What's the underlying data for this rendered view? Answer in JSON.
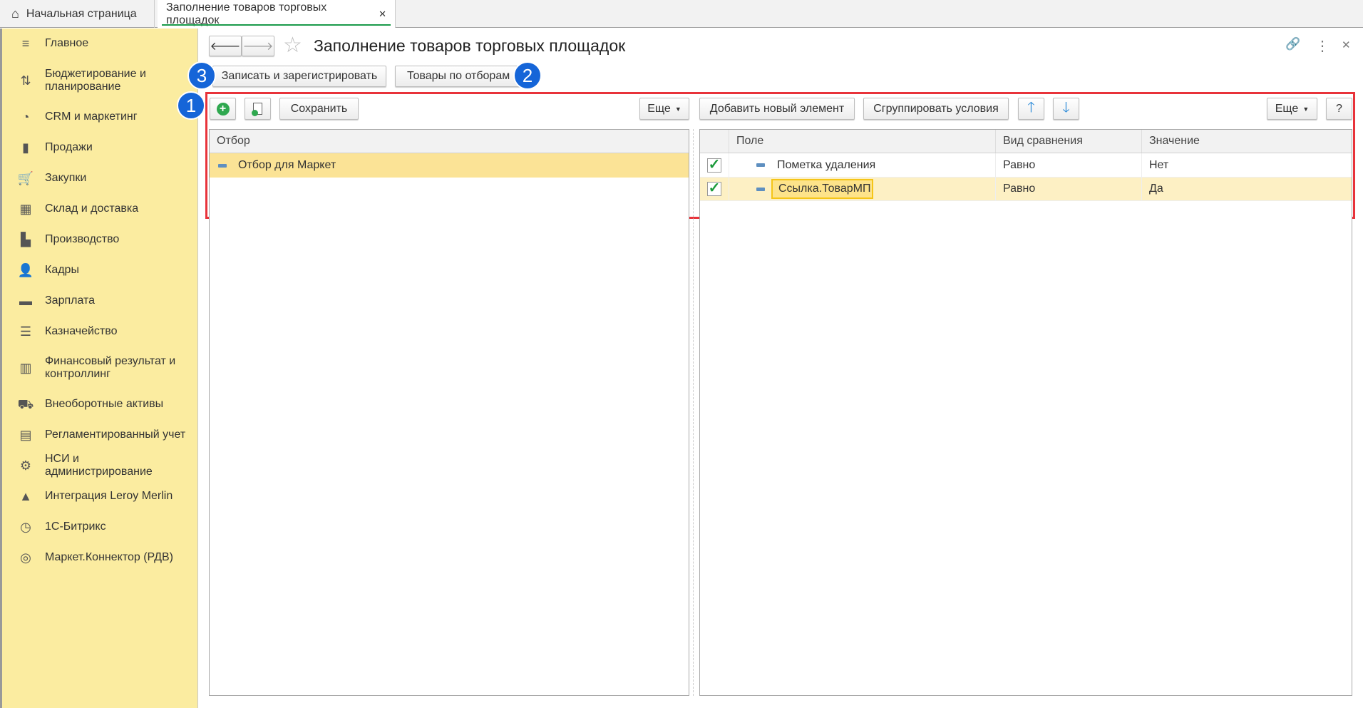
{
  "tabs": [
    {
      "label": "Начальная страница",
      "icon": "home-icon"
    },
    {
      "label": "Заполнение товаров торговых площадок",
      "close": "✕"
    }
  ],
  "sidebar": {
    "items": [
      {
        "label": "Главное",
        "icon": "≡"
      },
      {
        "label": "Бюджетирование и планирование",
        "icon": "⇅"
      },
      {
        "label": "CRM и маркетинг",
        "icon": "◔"
      },
      {
        "label": "Продажи",
        "icon": "▮"
      },
      {
        "label": "Закупки",
        "icon": "🛒"
      },
      {
        "label": "Склад и доставка",
        "icon": "▦"
      },
      {
        "label": "Производство",
        "icon": "▙"
      },
      {
        "label": "Кадры",
        "icon": "👤"
      },
      {
        "label": "Зарплата",
        "icon": "▬"
      },
      {
        "label": "Казначейство",
        "icon": "☰"
      },
      {
        "label": "Финансовый результат и контроллинг",
        "icon": "▥"
      },
      {
        "label": "Внеоборотные активы",
        "icon": "⛟"
      },
      {
        "label": "Регламентированный учет",
        "icon": "▤"
      },
      {
        "label": "НСИ и администрирование",
        "icon": "⚙"
      },
      {
        "label": "Интеграция Leroy Merlin",
        "icon": "▲"
      },
      {
        "label": "1С-Битрикс",
        "icon": "◷"
      },
      {
        "label": "Маркет.Коннектор (РДВ)",
        "icon": "◎"
      }
    ]
  },
  "header": {
    "title": "Заполнение товаров торговых площадок",
    "back": "🡐",
    "forward": "🡒",
    "star": "☆",
    "link": "🔗",
    "more": "⋮",
    "close": "✕"
  },
  "commands": {
    "write_register": "Записать и зарегистрировать",
    "goods_by_filters": "Товары по отборам"
  },
  "badges": {
    "one": "1",
    "two": "2",
    "three": "3"
  },
  "left": {
    "save": "Сохранить",
    "more": "Еще",
    "column": "Отбор",
    "rows": [
      {
        "label": "Отбор для Маркет"
      }
    ]
  },
  "right": {
    "add": "Добавить новый элемент",
    "group": "Сгруппировать условия",
    "up": "🡑",
    "down": "🡓",
    "more": "Еще",
    "help": "?",
    "columns": [
      "Поле",
      "Вид сравнения",
      "Значение"
    ],
    "rows": [
      {
        "checked": "✓",
        "field": "Пометка удаления",
        "comparison": "Равно",
        "value": "Нет"
      },
      {
        "checked": "✓",
        "field": "Ссылка.ТоварМП",
        "comparison": "Равно",
        "value": "Да"
      }
    ]
  },
  "colors": {
    "sidebar": "#fbeca0",
    "selected": "#fbe396",
    "annotation": "#e8333a",
    "badge": "#1565d8"
  }
}
